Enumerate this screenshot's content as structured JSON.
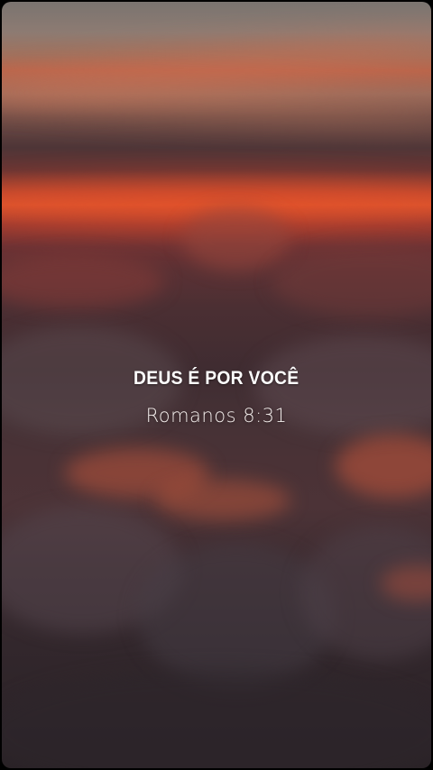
{
  "caption": {
    "title": "DEUS É POR VOCÊ",
    "reference": "Romanos 8:31"
  },
  "colors": {
    "sunset_orange": "#d9542e",
    "cloud_dark": "#3f2c31",
    "text": "#ffffff"
  }
}
